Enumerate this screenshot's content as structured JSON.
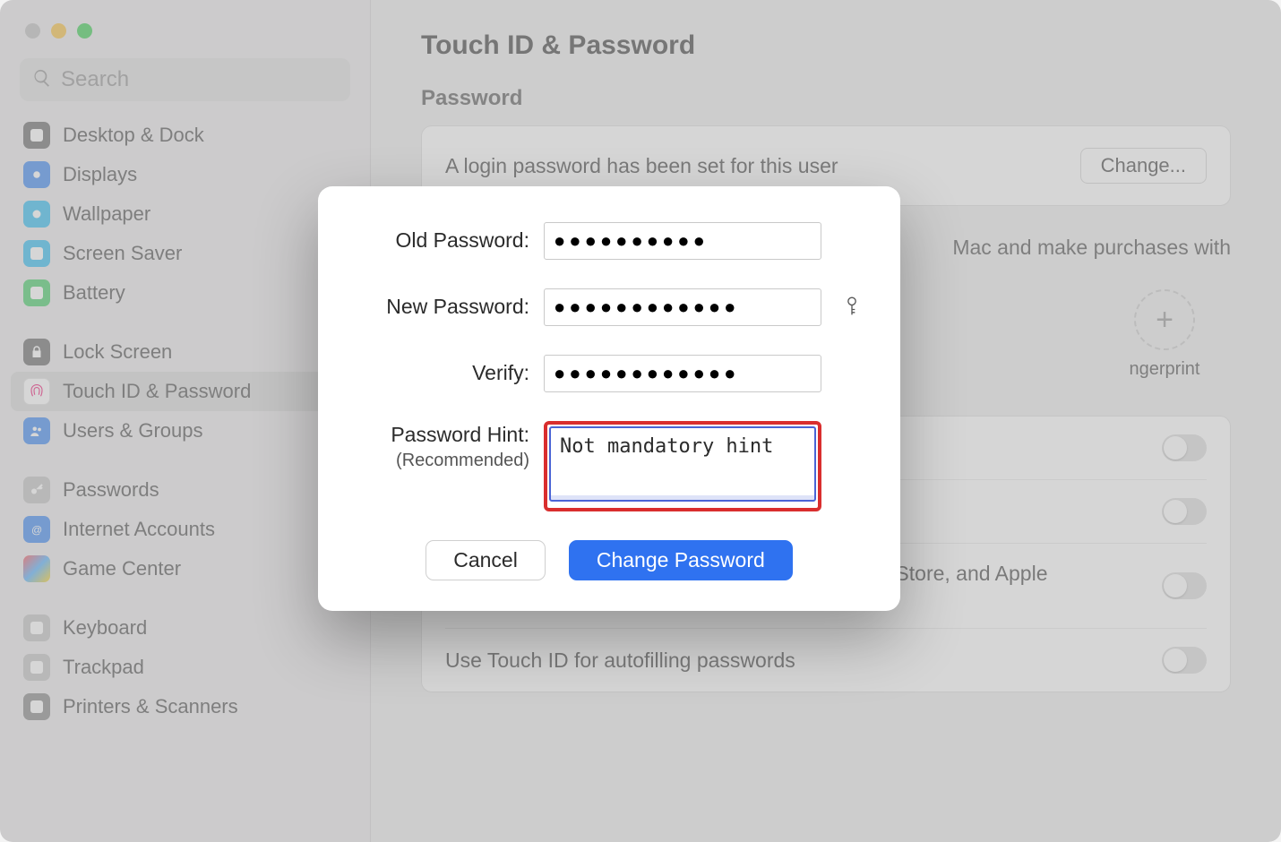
{
  "search": {
    "placeholder": "Search"
  },
  "sidebar": {
    "groups": [
      {
        "items": [
          {
            "label": "Desktop & Dock"
          },
          {
            "label": "Displays"
          },
          {
            "label": "Wallpaper"
          },
          {
            "label": "Screen Saver"
          },
          {
            "label": "Battery"
          }
        ]
      },
      {
        "items": [
          {
            "label": "Lock Screen"
          },
          {
            "label": "Touch ID & Password"
          },
          {
            "label": "Users & Groups"
          }
        ]
      },
      {
        "items": [
          {
            "label": "Passwords"
          },
          {
            "label": "Internet Accounts"
          },
          {
            "label": "Game Center"
          }
        ]
      },
      {
        "items": [
          {
            "label": "Keyboard"
          },
          {
            "label": "Trackpad"
          },
          {
            "label": "Printers & Scanners"
          }
        ]
      }
    ]
  },
  "page": {
    "title": "Touch ID & Password",
    "password_section": "Password",
    "password_status": "A login password has been set for this user",
    "change_button": "Change...",
    "touchid_desc_partial": "Mac and make purchases with",
    "add_fingerprint": "ngerprint",
    "toggles": [
      {
        "label": "Use Touch ID for purchases in iTunes Store, App Store, and Apple Books"
      },
      {
        "label": "Use Touch ID for autofilling passwords"
      }
    ]
  },
  "dialog": {
    "old_label": "Old Password:",
    "old_value": "●●●●●●●●●●",
    "new_label": "New Password:",
    "new_value": "●●●●●●●●●●●●",
    "verify_label": "Verify:",
    "verify_value": "●●●●●●●●●●●●",
    "hint_label": "Password Hint:",
    "hint_sub": "(Recommended)",
    "hint_value": "Not mandatory hint",
    "cancel": "Cancel",
    "confirm": "Change Password"
  }
}
